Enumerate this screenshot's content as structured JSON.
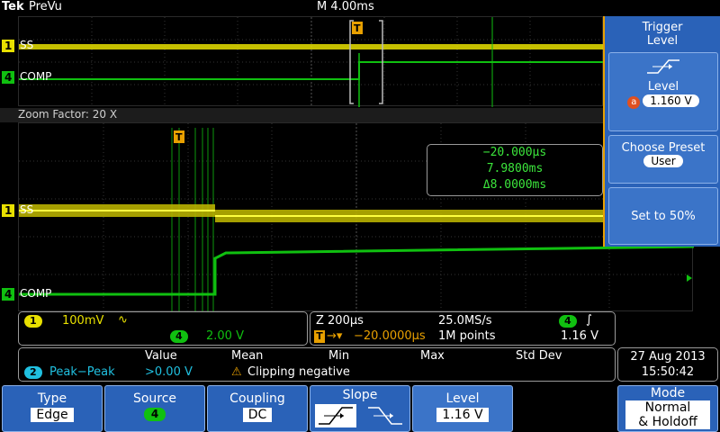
{
  "header": {
    "brand": "Tek",
    "mode": "PreVu",
    "timebase": "M 4.00ms"
  },
  "zoom": {
    "label": "Zoom Factor: 20 X"
  },
  "channels": {
    "ch1": {
      "number": "1",
      "name": "SS",
      "color": "#e8e000"
    },
    "ch4": {
      "number": "4",
      "name": "COMP",
      "color": "#10c010"
    }
  },
  "cursor_readout": {
    "line1": "−20.000µs",
    "line2": "7.9800ms",
    "line3": "Δ8.0000ms"
  },
  "side_menu": {
    "title_line1": "Trigger",
    "title_line2": "Level",
    "level_label": "Level",
    "level_badge": "a",
    "level_value": "1.160 V",
    "preset_label": "Choose Preset",
    "preset_value": "User",
    "set50_label": "Set to 50%"
  },
  "channel_status": {
    "ch1_num": "1",
    "ch1_scale": "100mV",
    "ch1_bw": "∿",
    "ch4_num": "4",
    "ch4_scale": "2.00 V"
  },
  "horizontal_status": {
    "zoom_scale": "Z 200µs",
    "sample_rate": "25.0MS/s",
    "trig_src": "4",
    "trig_slope": "∫",
    "trig_pos": "−20.0000µs",
    "record_length": "1M points",
    "trig_level": "1.16 V"
  },
  "measurement": {
    "headers": [
      "Value",
      "Mean",
      "Min",
      "Max",
      "Std Dev"
    ],
    "ch_num": "2",
    "type": "Peak−Peak",
    "value": ">0.00 V",
    "warning": "Clipping negative"
  },
  "datetime": {
    "date": "27 Aug 2013",
    "time": "15:50:42"
  },
  "bottom_menu": {
    "type_label": "Type",
    "type_value": "Edge",
    "source_label": "Source",
    "source_value": "4",
    "coupling_label": "Coupling",
    "coupling_value": "DC",
    "slope_label": "Slope",
    "level_label": "Level",
    "level_value": "1.16 V",
    "mode_label": "Mode",
    "mode_value_1": "Normal",
    "mode_value_2": "& Holdoff"
  },
  "colors": {
    "ch1": "#e8e000",
    "ch4": "#10c010",
    "menu_blue": "#2a62b8",
    "trigger_orange": "#e8a000",
    "readout_green": "#3ce63c"
  }
}
